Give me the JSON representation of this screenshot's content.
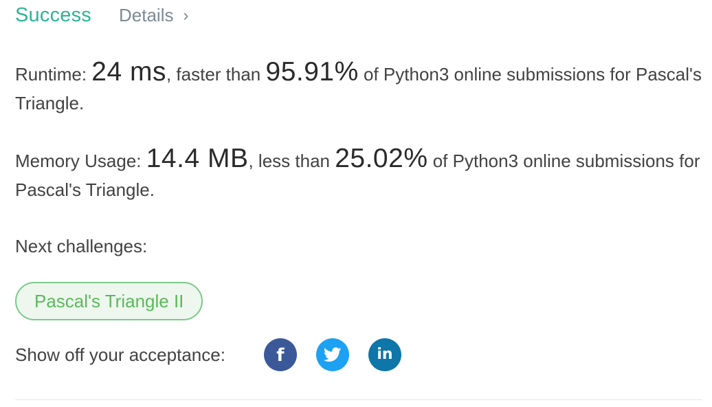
{
  "header": {
    "status": "Success",
    "details_label": "Details",
    "chevron": "›"
  },
  "runtime": {
    "label": "Runtime: ",
    "value": "24 ms",
    "mid": ", faster than ",
    "percent": "95.91%",
    "tail": " of Python3 online submissions for Pascal's Triangle."
  },
  "memory": {
    "label": "Memory Usage: ",
    "value": "14.4 MB",
    "mid": ", less than ",
    "percent": "25.02%",
    "tail": " of Python3 online submissions for Pascal's Triangle."
  },
  "next": {
    "label": "Next challenges:",
    "challenges": [
      "Pascal's Triangle II"
    ]
  },
  "share": {
    "label": "Show off your acceptance:",
    "icons": {
      "facebook": "f",
      "twitter": "twitter-bird",
      "linkedin": "in"
    }
  },
  "colors": {
    "success": "#2db396",
    "facebook": "#3b5998",
    "twitter": "#1da1f2",
    "linkedin": "#0e76a8",
    "pill_border": "#7cc98a",
    "pill_bg": "#edf7ee"
  }
}
